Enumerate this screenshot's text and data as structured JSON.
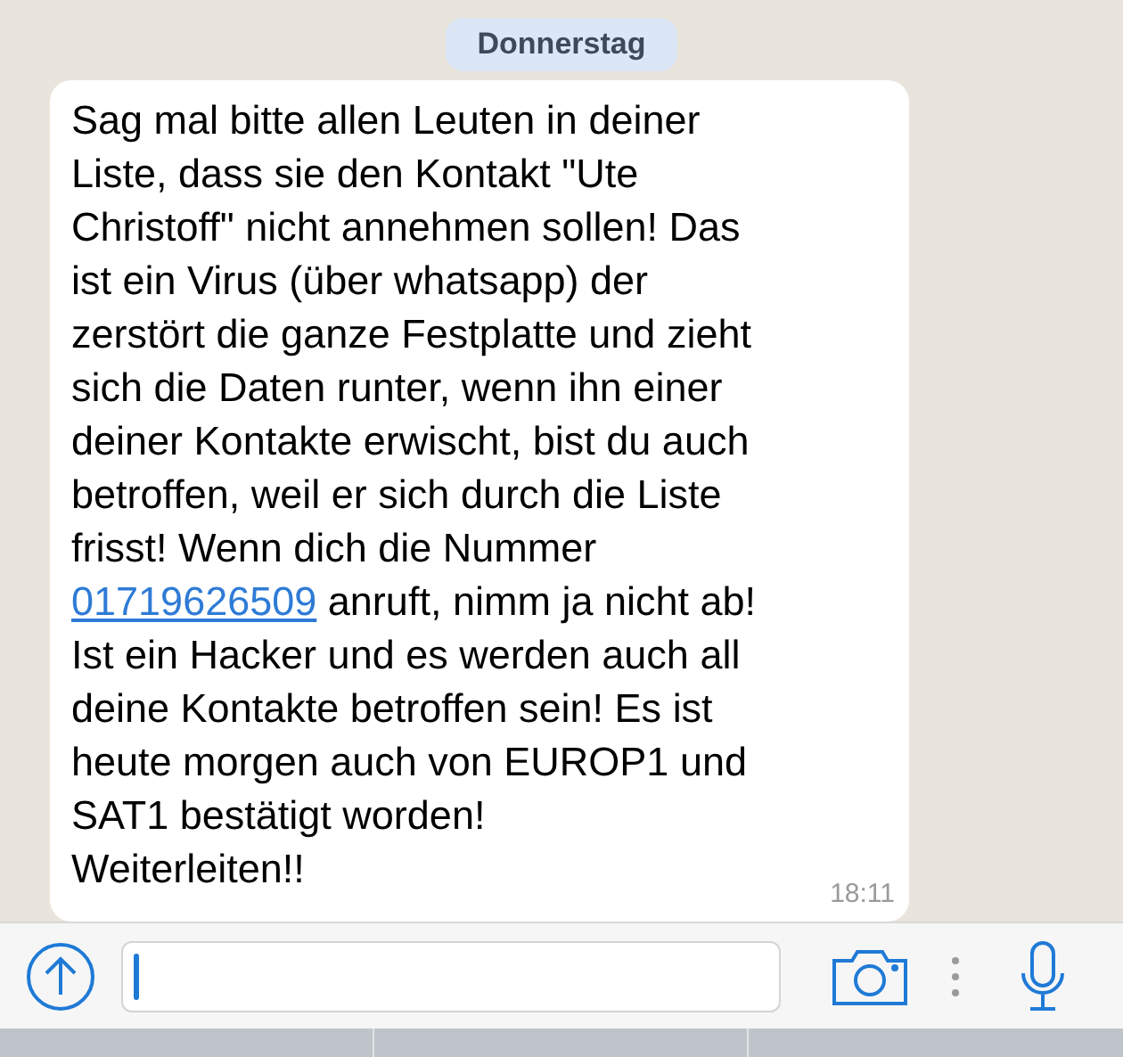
{
  "date_badge": "Donnerstag",
  "message": {
    "lines": [
      [
        {
          "kind": "text",
          "text": "Sag mal bitte allen Leuten in deiner"
        }
      ],
      [
        {
          "kind": "text",
          "text": "Liste, dass sie den Kontakt \"Ute"
        }
      ],
      [
        {
          "kind": "text",
          "text": "Christoff\" nicht annehmen sollen! Das"
        }
      ],
      [
        {
          "kind": "text",
          "text": "ist ein Virus (über whatsapp) der"
        }
      ],
      [
        {
          "kind": "text",
          "text": "zerstört die ganze Festplatte und zieht"
        }
      ],
      [
        {
          "kind": "text",
          "text": "sich die Daten runter, wenn ihn einer"
        }
      ],
      [
        {
          "kind": "text",
          "text": "deiner Kontakte erwischt, bist du auch"
        }
      ],
      [
        {
          "kind": "text",
          "text": "betroffen, weil er sich durch die Liste"
        }
      ],
      [
        {
          "kind": "text",
          "text": "frisst! Wenn dich die Nummer"
        }
      ],
      [
        {
          "kind": "link",
          "text": "01719626509"
        },
        {
          "kind": "text",
          "text": " anruft, nimm ja nicht ab!"
        }
      ],
      [
        {
          "kind": "text",
          "text": "Ist ein Hacker und es werden auch all"
        }
      ],
      [
        {
          "kind": "text",
          "text": "deine Kontakte betroffen sein! Es ist"
        }
      ],
      [
        {
          "kind": "text",
          "text": "heute morgen auch von EUROP1 und"
        }
      ],
      [
        {
          "kind": "text",
          "text": "SAT1 bestätigt worden!"
        }
      ],
      [
        {
          "kind": "text",
          "text": "Weiterleiten!!"
        }
      ]
    ],
    "time": "18:11"
  }
}
